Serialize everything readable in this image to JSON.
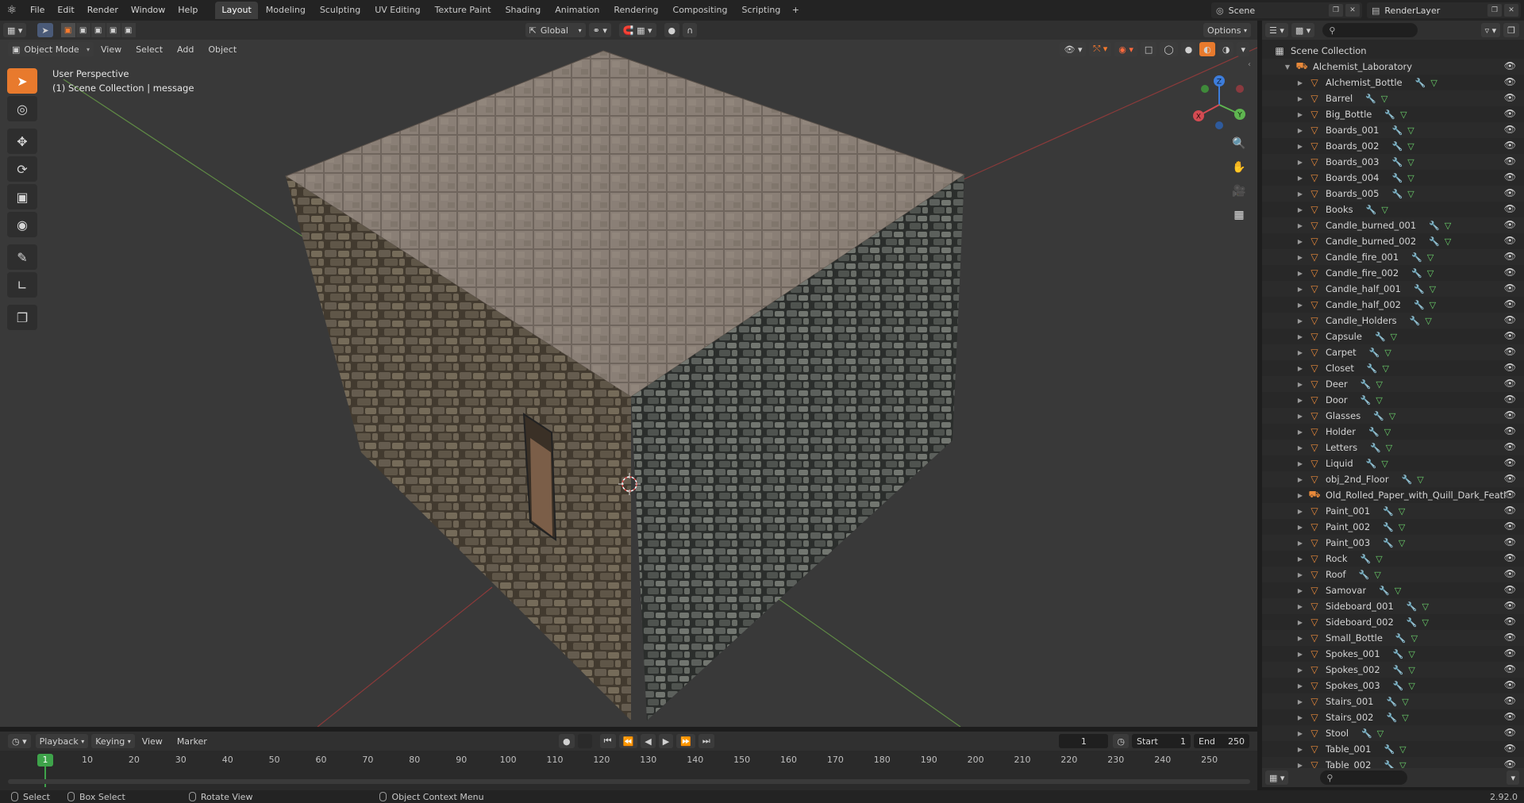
{
  "topbar": {
    "menu": [
      "File",
      "Edit",
      "Render",
      "Window",
      "Help"
    ],
    "workspaces": [
      "Layout",
      "Modeling",
      "Sculpting",
      "UV Editing",
      "Texture Paint",
      "Shading",
      "Animation",
      "Rendering",
      "Compositing",
      "Scripting"
    ],
    "active_workspace": "Layout",
    "scene": "Scene",
    "render_layer": "RenderLayer"
  },
  "viewport_header": {
    "mode": "Object Mode",
    "menus": [
      "View",
      "Select",
      "Add",
      "Object"
    ],
    "orientation": "Global",
    "options": "Options"
  },
  "viewport": {
    "perspective": "User Perspective",
    "collection_info": "(1) Scene Collection | message",
    "gizmo_axes": [
      "X",
      "Y",
      "Z"
    ]
  },
  "outliner": {
    "root": "Scene Collection",
    "collection": "Alchemist_Laboratory",
    "items": [
      "Alchemist_Bottle",
      "Barrel",
      "Big_Bottle",
      "Boards_001",
      "Boards_002",
      "Boards_003",
      "Boards_004",
      "Boards_005",
      "Books",
      "Candle_burned_001",
      "Candle_burned_002",
      "Candle_fire_001",
      "Candle_fire_002",
      "Candle_half_001",
      "Candle_half_002",
      "Candle_Holders",
      "Capsule",
      "Carpet",
      "Closet",
      "Deer",
      "Door",
      "Glasses",
      "Holder",
      "Letters",
      "Liquid",
      "obj_2nd_Floor",
      "Old_Rolled_Paper_with_Quill_Dark_Featl",
      "Paint_001",
      "Paint_002",
      "Paint_003",
      "Rock",
      "Roof",
      "Samovar",
      "Sideboard_001",
      "Sideboard_002",
      "Small_Bottle",
      "Spokes_001",
      "Spokes_002",
      "Spokes_003",
      "Stairs_001",
      "Stairs_002",
      "Stool",
      "Table_001",
      "Table_002"
    ]
  },
  "timeline": {
    "menus": [
      "Playback",
      "Keying",
      "View",
      "Marker"
    ],
    "current_frame": "1",
    "start_label": "Start",
    "start": "1",
    "end_label": "End",
    "end": "250",
    "ticks": [
      "10",
      "20",
      "30",
      "40",
      "50",
      "60",
      "70",
      "80",
      "90",
      "100",
      "110",
      "120",
      "130",
      "140",
      "150",
      "160",
      "170",
      "180",
      "190",
      "200",
      "210",
      "220",
      "230",
      "240",
      "250"
    ]
  },
  "statusbar": {
    "select": "Select",
    "box_select": "Box Select",
    "rotate_view": "Rotate View",
    "context_menu": "Object Context Menu",
    "version": "2.92.0"
  }
}
